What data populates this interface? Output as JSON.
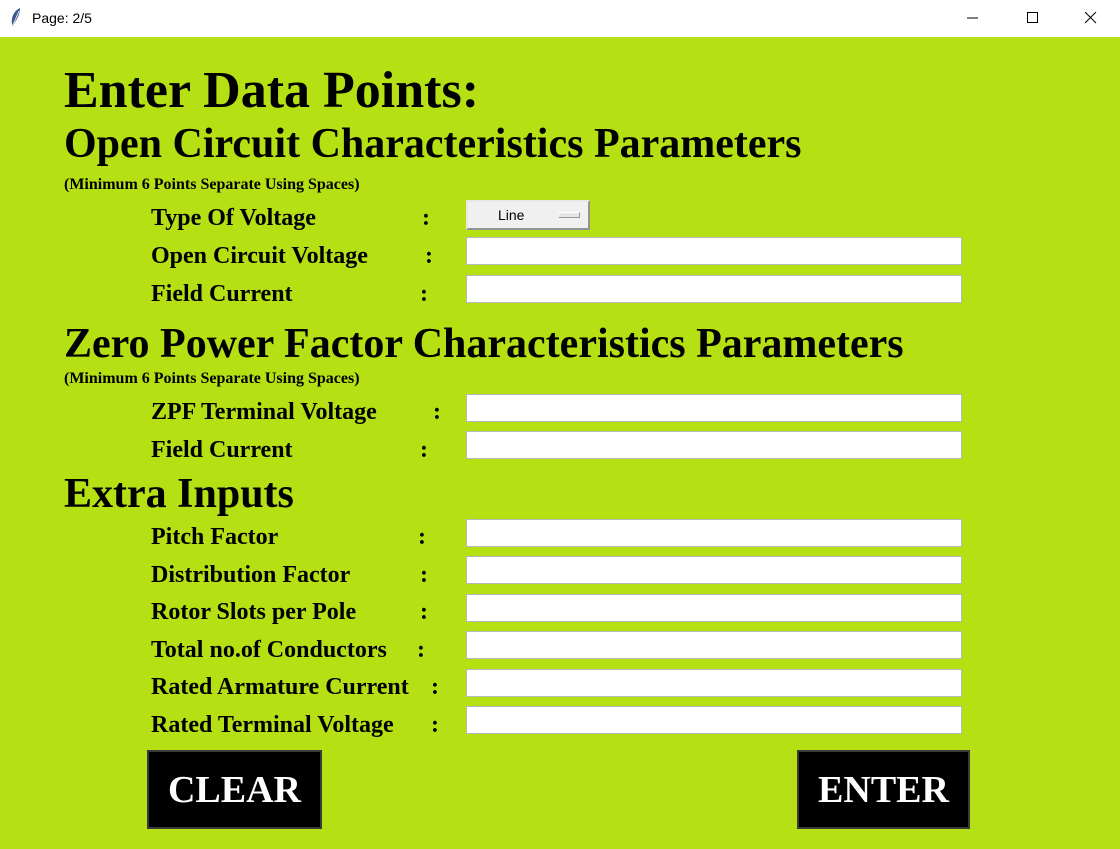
{
  "window": {
    "title": "Page: 2/5"
  },
  "page": {
    "heading": "Enter Data Points:",
    "occ": {
      "title": "Open Circuit Characteristics Parameters",
      "note": "(Minimum 6 Points Separate Using Spaces)",
      "type_of_voltage_label": "Type Of Voltage",
      "type_of_voltage_value": "Line",
      "open_circuit_voltage_label": "Open Circuit Voltage",
      "field_current_label": "Field Current"
    },
    "zpf": {
      "title": "Zero Power Factor Characteristics Parameters",
      "note": "(Minimum 6 Points Separate Using Spaces)",
      "terminal_voltage_label": "ZPF Terminal Voltage",
      "field_current_label": "Field Current"
    },
    "extra": {
      "title": "Extra Inputs",
      "pitch_factor_label": "Pitch Factor",
      "distribution_factor_label": "Distribution Factor",
      "rotor_slots_label": "Rotor Slots per Pole",
      "total_conductors_label": "Total no.of Conductors",
      "rated_armature_current_label": "Rated Armature Current",
      "rated_terminal_voltage_label": "Rated Terminal Voltage"
    },
    "colon": ":",
    "buttons": {
      "clear": "CLEAR",
      "enter": "ENTER"
    }
  },
  "colors": {
    "background": "#b5e014",
    "button": "#000000",
    "button_text": "#ffffff"
  }
}
